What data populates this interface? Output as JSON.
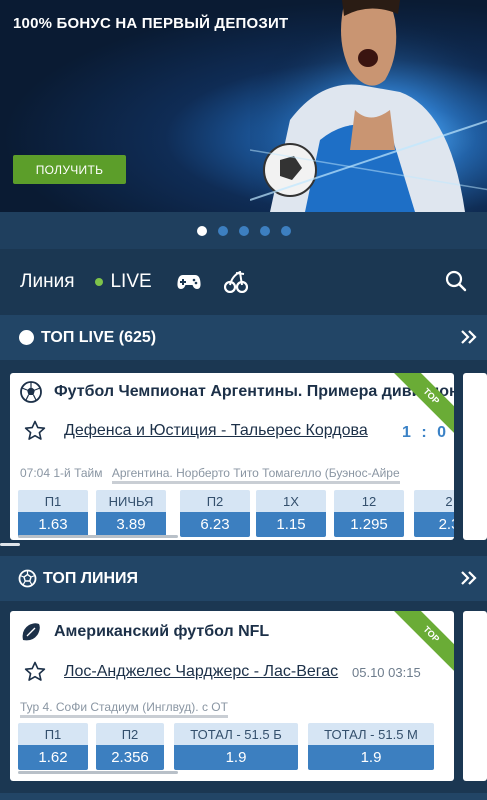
{
  "banner": {
    "title": "100% БОНУС НА ПЕРВЫЙ ДЕПОЗИТ",
    "button": "ПОЛУЧИТЬ",
    "dots_count": 5,
    "active_dot": 0,
    "accent": "#5c9e2a"
  },
  "nav": {
    "line": "Линия",
    "live": "LIVE",
    "icons": [
      "gamepad-icon",
      "cherries-icon",
      "search-icon"
    ]
  },
  "top_live": {
    "title": "ТОП LIVE (625)",
    "card": {
      "league": "Футбол Чемпионат Аргентины. Примера дивизион",
      "badge": "TOP",
      "match": "Дефенса и Юстиция - Тальерес Кордова",
      "score": "1 : 0",
      "time": "07:04 1-й Тайм",
      "venue": "Аргентина. Норберто Тито Томагелло (Буэнос-Айре",
      "odds": [
        {
          "label": "П1",
          "value": "1.63"
        },
        {
          "label": "НИЧЬЯ",
          "value": "3.89"
        },
        {
          "label": "П2",
          "value": "6.23"
        },
        {
          "label": "1Х",
          "value": "1.15"
        },
        {
          "label": "12",
          "value": "1.295"
        },
        {
          "label": "2",
          "value": "2.3"
        }
      ]
    }
  },
  "top_line": {
    "title": "ТОП ЛИНИЯ",
    "card": {
      "league": "Американский футбол NFL",
      "badge": "TOP",
      "match": "Лос-Анджелес Чарджерс - Лас-Вегас",
      "date": "05.10 03:15",
      "venue": "Тур 4. СоФи Стадиум (Инглвуд). с ОТ",
      "odds": [
        {
          "label": "П1",
          "value": "1.62"
        },
        {
          "label": "П2",
          "value": "2.356"
        },
        {
          "label": "ТОТАЛ - 51.5 Б",
          "value": "1.9"
        },
        {
          "label": "ТОТАЛ - 51.5 М",
          "value": "1.9"
        }
      ]
    }
  },
  "colors": {
    "background": "#1b3752",
    "section": "#224566",
    "odds_value": "#3c7fc0",
    "odds_label": "#d6e5f4",
    "ribbon": "#6aac36",
    "live_dot": "#7ec34a"
  }
}
